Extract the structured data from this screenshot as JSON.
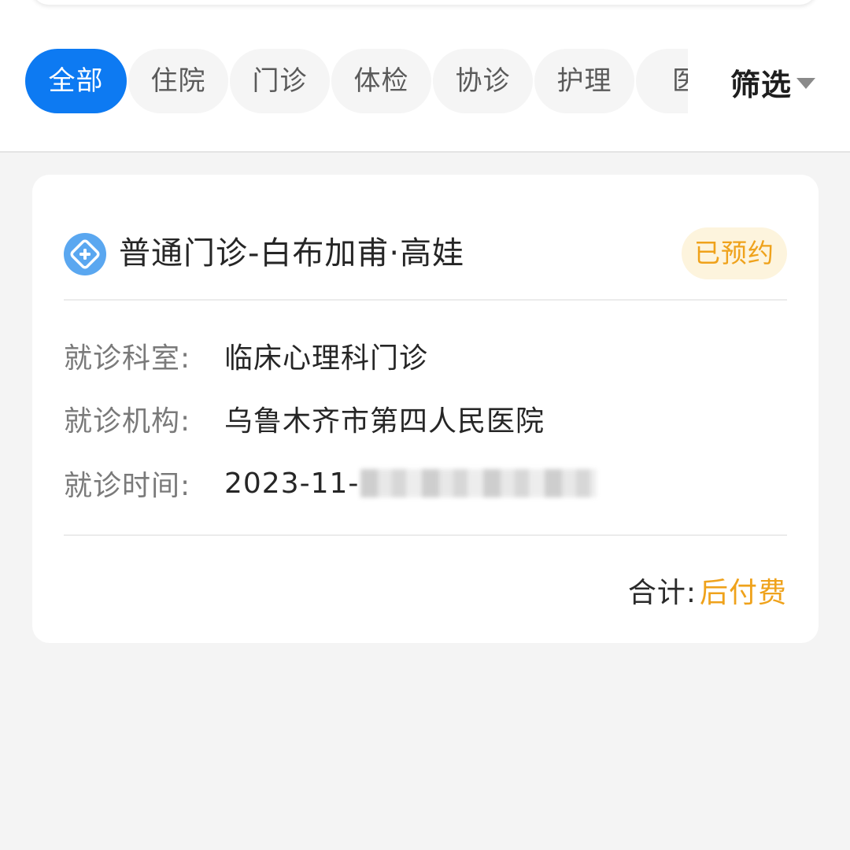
{
  "filter_tabs": [
    {
      "label": "全部",
      "active": true
    },
    {
      "label": "住院",
      "active": false
    },
    {
      "label": "门诊",
      "active": false
    },
    {
      "label": "体检",
      "active": false
    },
    {
      "label": "协诊",
      "active": false
    },
    {
      "label": "护理",
      "active": false
    },
    {
      "label": "医",
      "active": false
    }
  ],
  "filter": {
    "label": "筛选",
    "icon": "caret-down-icon"
  },
  "record": {
    "icon": "clinic-plus-icon",
    "title": "普通门诊-白布加甫·高娃",
    "status": "已预约",
    "department_label": "就诊科室:",
    "department": "临床心理科门诊",
    "institution_label": "就诊机构:",
    "institution": "乌鲁木齐市第四人民医院",
    "time_label": "就诊时间:",
    "time_visible": "2023-11-",
    "total_label": "合计:",
    "total_value": "后付费"
  },
  "colors": {
    "accent": "#0d7af2",
    "status": "#efa21b",
    "icon": "#5aa7f0"
  }
}
